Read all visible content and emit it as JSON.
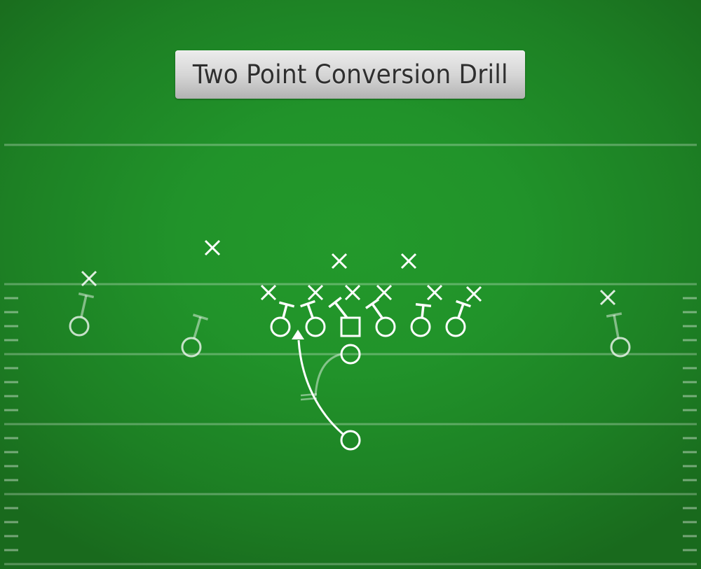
{
  "title": "Two Point Conversion Drill",
  "colors": {
    "field_center": "#23992b",
    "field_edge": "#196a1d",
    "marking": "#ffffff",
    "title_text": "#2f2f2f"
  },
  "diagram": {
    "type": "football-play",
    "offense": [
      {
        "id": "wr-left",
        "role": "Wide receiver",
        "shape": "circle",
        "faded": true
      },
      {
        "id": "slot-left",
        "role": "Slot receiver",
        "shape": "circle",
        "faded": true
      },
      {
        "id": "lt",
        "role": "Left tackle",
        "shape": "circle",
        "faded": false
      },
      {
        "id": "lg",
        "role": "Left guard",
        "shape": "circle",
        "faded": false
      },
      {
        "id": "c",
        "role": "Center",
        "shape": "square",
        "faded": false
      },
      {
        "id": "rg",
        "role": "Right guard",
        "shape": "circle",
        "faded": false
      },
      {
        "id": "rt",
        "role": "Right tackle",
        "shape": "circle",
        "faded": false
      },
      {
        "id": "te",
        "role": "Tight end",
        "shape": "circle",
        "faded": false
      },
      {
        "id": "wr-right",
        "role": "Wide receiver",
        "shape": "circle",
        "faded": true
      },
      {
        "id": "qb",
        "role": "Quarterback",
        "shape": "circle",
        "faded": false
      },
      {
        "id": "rb",
        "role": "Running back",
        "shape": "circle",
        "faded": false
      }
    ],
    "defense_count": 11,
    "routes": [
      {
        "from": "rb",
        "kind": "run",
        "ending": "arrow",
        "description": "Running back curls up through the left A-gap"
      },
      {
        "from": "qb",
        "kind": "handoff-fake",
        "ending": "block",
        "faded": true,
        "description": "Quarterback reverse pivot to meet running back"
      }
    ],
    "blocks": [
      {
        "from": "wr-left",
        "faded": true
      },
      {
        "from": "slot-left",
        "faded": true
      },
      {
        "from": "lt",
        "faded": false
      },
      {
        "from": "lg",
        "faded": false
      },
      {
        "from": "c",
        "faded": false
      },
      {
        "from": "rg",
        "faded": false
      },
      {
        "from": "rt",
        "faded": false
      },
      {
        "from": "te",
        "faded": false
      },
      {
        "from": "wr-right",
        "faded": true
      }
    ]
  }
}
